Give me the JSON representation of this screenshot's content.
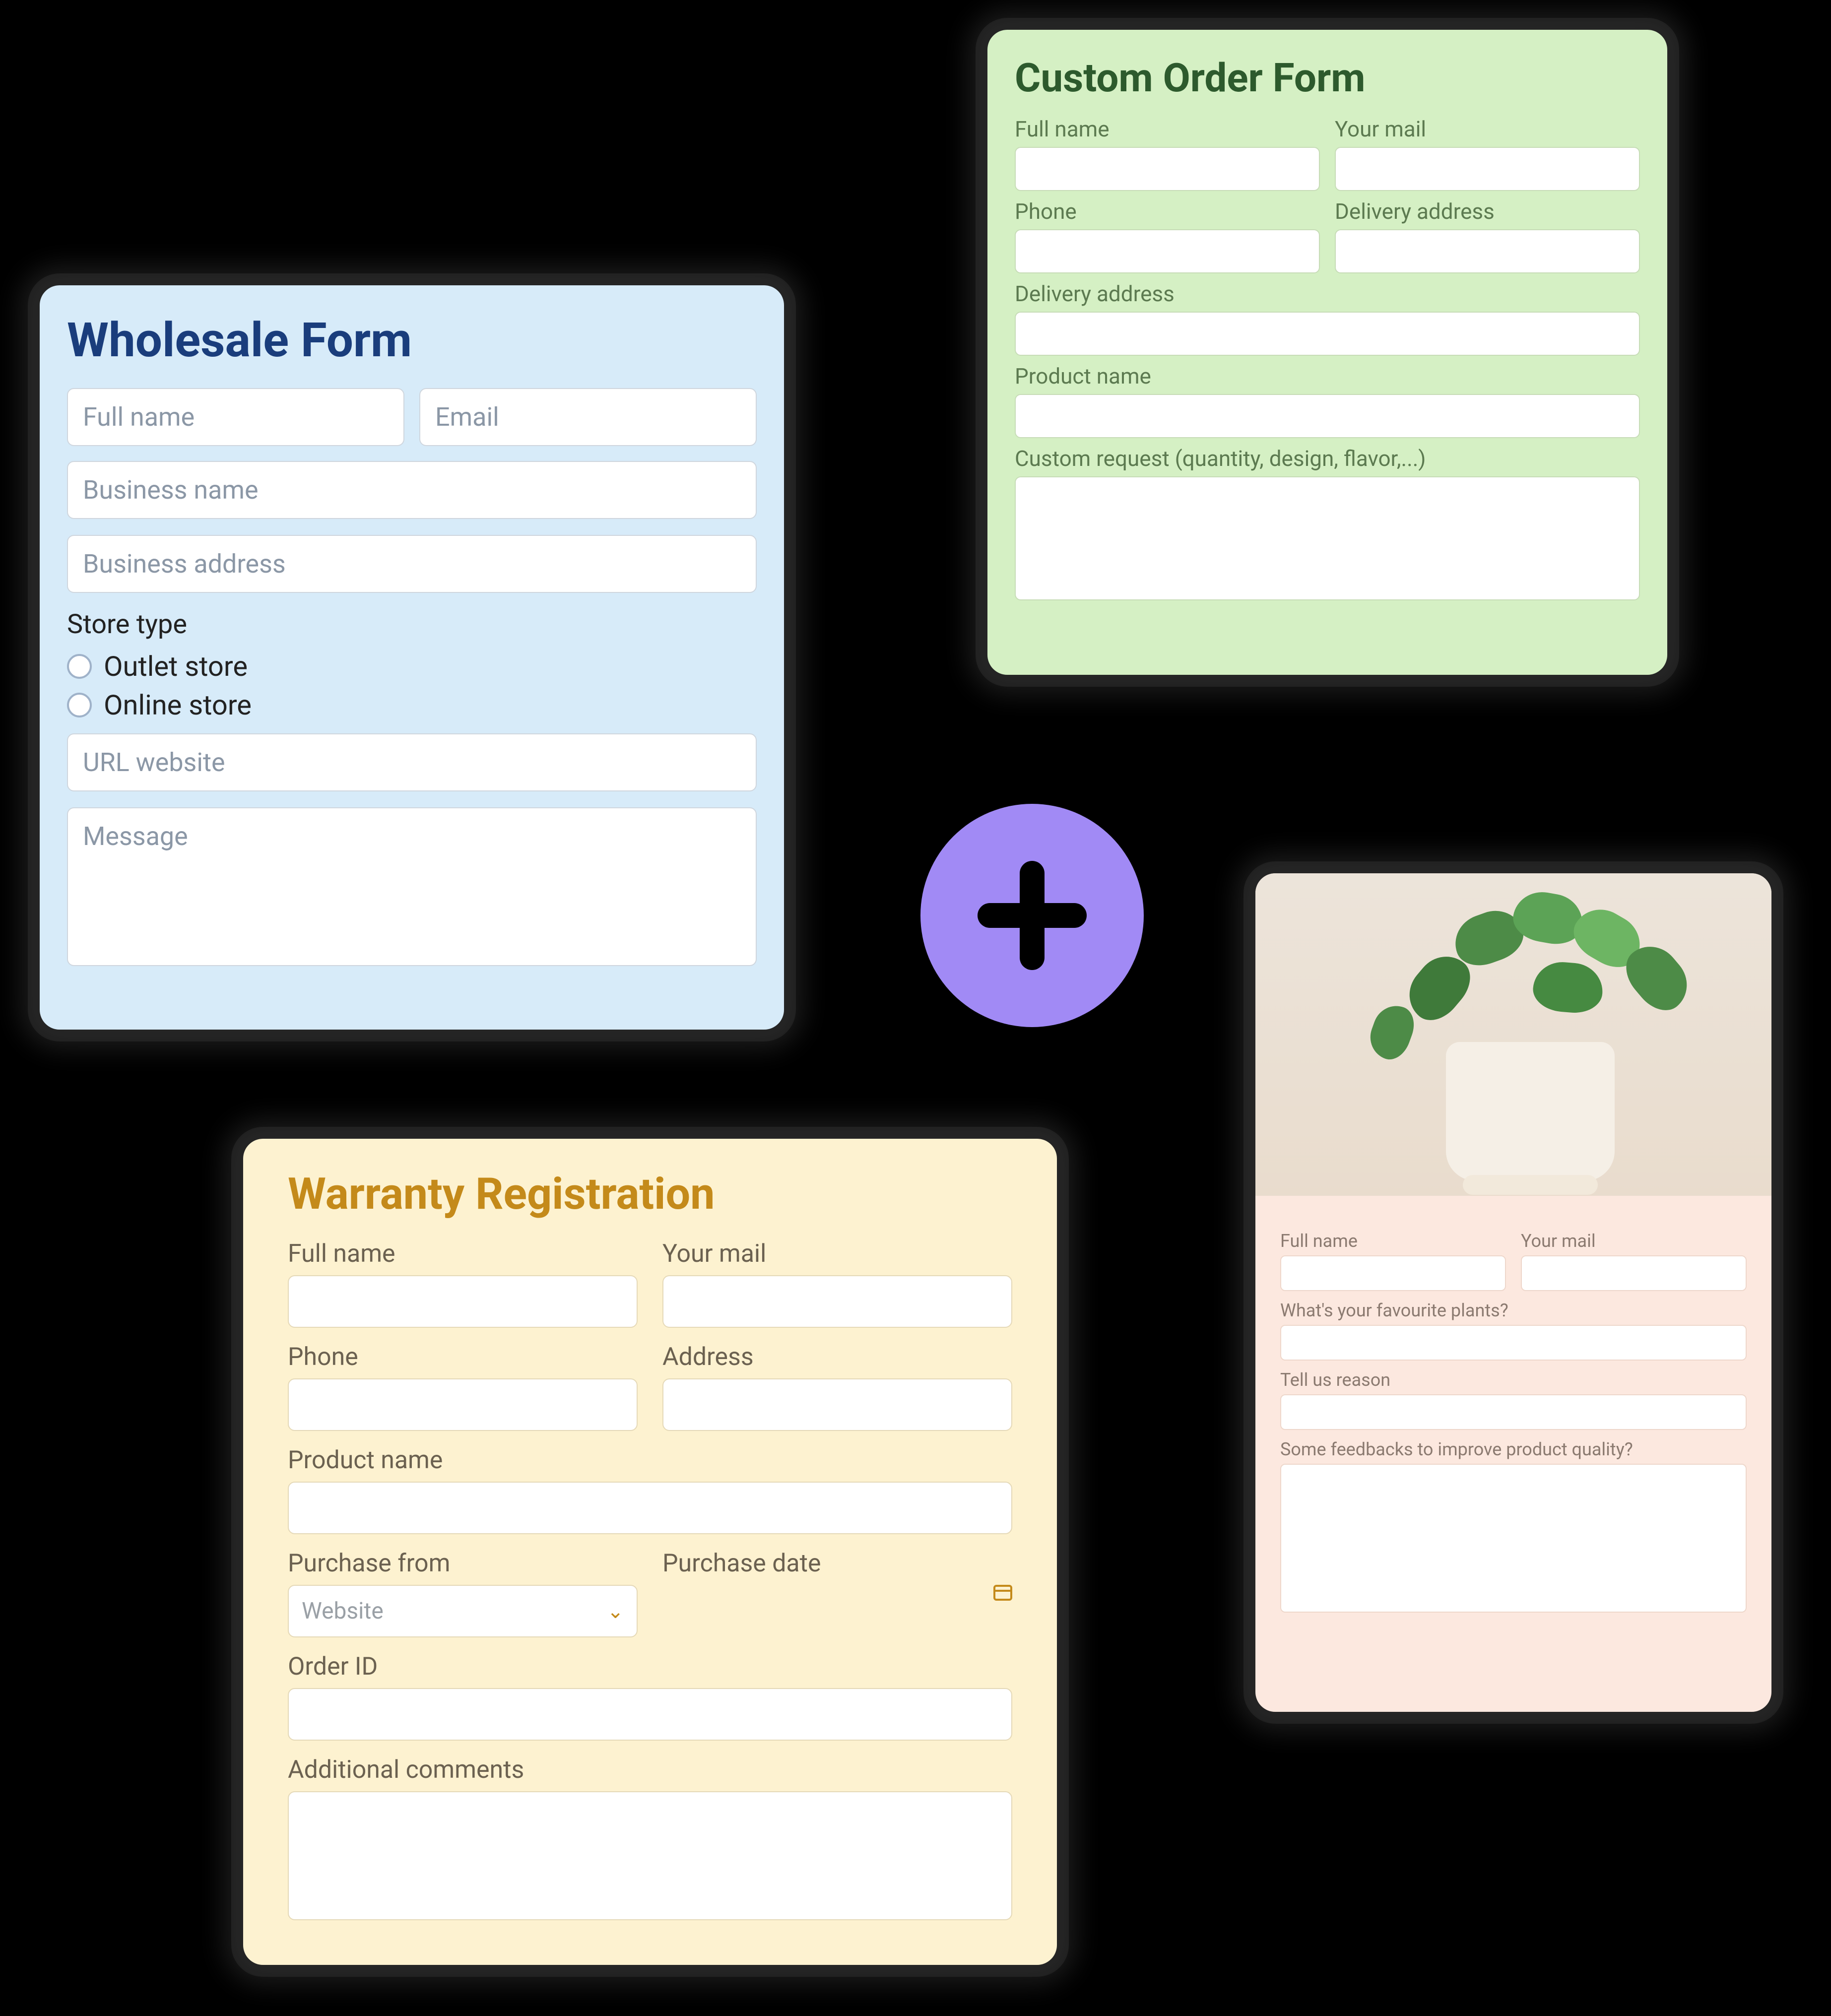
{
  "wholesale": {
    "title": "Wholesale Form",
    "full_name_ph": "Full name",
    "email_ph": "Email",
    "business_name_ph": "Business name",
    "business_address_ph": "Business address",
    "store_type_label": "Store type",
    "radio_outlet": "Outlet store",
    "radio_online": "Online store",
    "url_ph": "URL website",
    "message_ph": "Message"
  },
  "custom": {
    "title": "Custom Order Form",
    "full_name": "Full name",
    "mail": "Your mail",
    "phone": "Phone",
    "delivery_addr": "Delivery address",
    "delivery_addr2": "Delivery address",
    "product_name": "Product name",
    "request": "Custom request (quantity, design, flavor,...)"
  },
  "warranty": {
    "title": "Warranty Registration",
    "full_name": "Full name",
    "mail": "Your mail",
    "phone": "Phone",
    "address": "Address",
    "product_name": "Product name",
    "purchase_from": "Purchase from",
    "purchase_from_value": "Website",
    "purchase_date": "Purchase date",
    "order_id": "Order ID",
    "comments": "Additional comments"
  },
  "feedback": {
    "full_name": "Full name",
    "mail": "Your mail",
    "fav_plants": "What's your favourite plants?",
    "reason": "Tell us reason",
    "improve": "Some feedbacks to improve product quality?"
  }
}
